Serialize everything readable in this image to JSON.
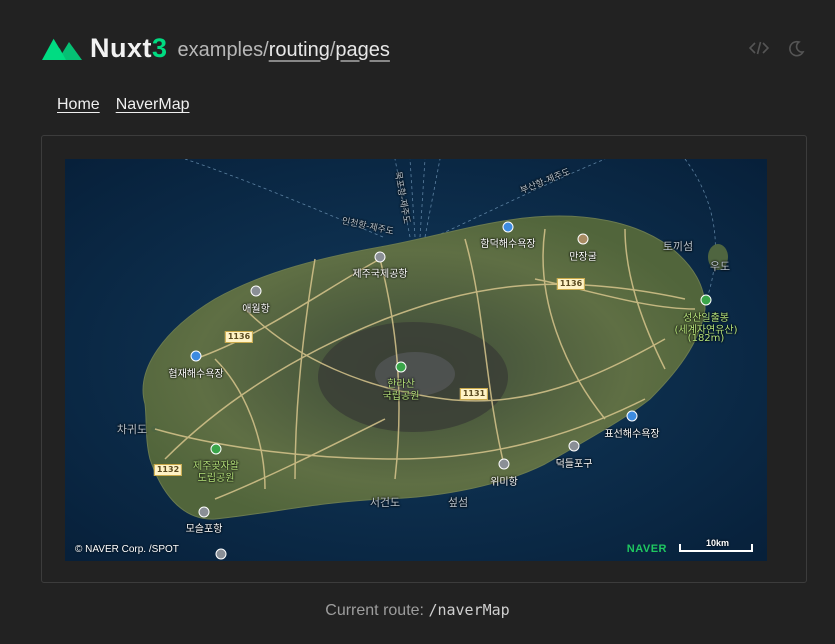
{
  "header": {
    "logo_text": "Nuxt",
    "logo_version": "3",
    "breadcrumb_prefix": "examples/",
    "breadcrumb_routing": "routing",
    "breadcrumb_sep": "/",
    "breadcrumb_pages": "pages",
    "icons": [
      "code-icon",
      "moon-icon"
    ]
  },
  "nav": {
    "home": "Home",
    "naver_map": "NaverMap"
  },
  "map": {
    "labels": {
      "hamdeok": "함덕해수욕장",
      "airport": "제주국제공항",
      "manjanggul": "만장굴",
      "aewol": "애월항",
      "hyeopjae": "협재해수욕장",
      "hallasan_1": "한라산",
      "hallasan_2": "국립공원",
      "seongsan_1": "성산일출봉",
      "seongsan_2": "(세계자연유산)",
      "seongsan_3": "(182m)",
      "pyoseon": "표선해수욕장",
      "chagwido": "차귀도",
      "jeju_park_1": "제주곶자왈",
      "jeju_park_2": "도립공원",
      "wimi": "위미항",
      "deokdeul": "덕들포구",
      "moseulpo": "모슬포항",
      "seogeondo": "서건도",
      "seopseom": "섶섬",
      "tokkiseom": "토끼섬",
      "udo": "우도",
      "ferry_busan": "부산항-제주도",
      "ferry_incheon": "인천항-제주도",
      "ferry_mokpo": "목포항-제주도"
    },
    "road_shields": [
      "1136",
      "1136",
      "1131",
      "1132"
    ],
    "copyright": "© NAVER Corp. /SPOT",
    "provider_logo": "NAVER",
    "scale_label": "10km"
  },
  "footer": {
    "route_label": "Current route:",
    "route_path": "/naverMap"
  }
}
